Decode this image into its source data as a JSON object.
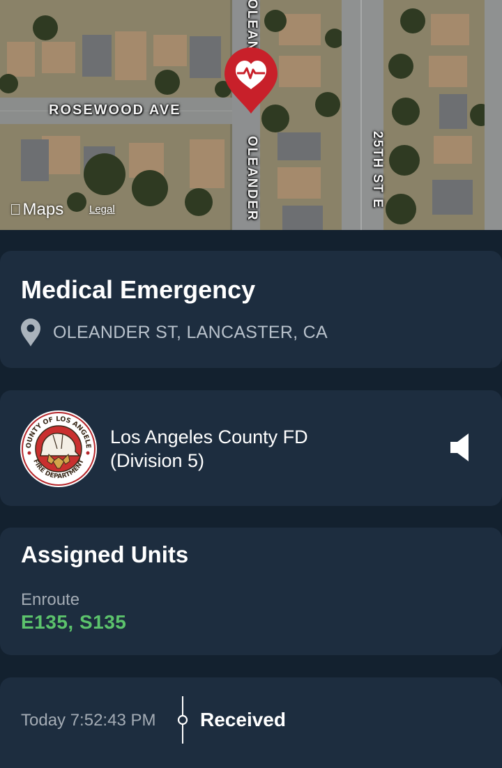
{
  "map": {
    "streets": {
      "horizontal": "ROSEWOOD AVE",
      "vertical_top": "OLEANDE",
      "vertical_bottom": "OLEANDER",
      "vertical_right": "25TH ST E"
    },
    "brand_label": "Maps",
    "legal_label": "Legal",
    "pin_icon": "heart-pulse-pin-icon",
    "pin_color": "#c8202a"
  },
  "incident": {
    "title": "Medical Emergency",
    "address": "OLEANDER ST, LANCASTER, CA",
    "location_icon": "location-pin-icon"
  },
  "department": {
    "name_line1": "Los Angeles County FD",
    "name_line2": "(Division 5)",
    "logo_icon": "la-county-fire-department-seal",
    "logo_text_top": "COUNTY OF LOS ANGELES",
    "logo_text_bottom": "FIRE DEPARTMENT",
    "audio_icon": "speaker-icon"
  },
  "units": {
    "heading": "Assigned Units",
    "status": "Enroute",
    "list": "E135, S135",
    "status_color": "#5cc36c"
  },
  "timeline": {
    "time": "Today 7:52:43 PM",
    "event": "Received"
  },
  "colors": {
    "background": "#13212f",
    "card": "#1d2d3f",
    "muted_text": "#a4acb5"
  }
}
